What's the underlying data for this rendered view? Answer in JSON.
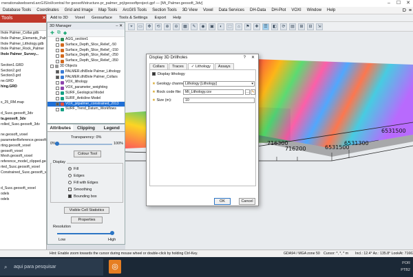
{
  "titlebar": {
    "text": "rnerationalwebsend.arcGIS/oil/central for geosoft/structure.pr_palmer_prj/geosoftproject.gpf — [Mt_Palmer.geosoft_3dv]",
    "controls": [
      "–",
      "☐",
      "✕"
    ]
  },
  "menubar": {
    "items": [
      "Database Tools",
      "Coordinates",
      "Grid and Image",
      "Map Tools",
      "ArcGIS Tools",
      "Section Tools",
      "3D View",
      "Voxel",
      "Data Services",
      "DH-Data",
      "DH-Plot",
      "VOXI",
      "Window",
      "Help"
    ],
    "right_icons": [
      "D",
      "≡"
    ]
  },
  "left_panel": {
    "header": "Tools",
    "header_close": "✕",
    "items": [
      {
        "text": "Ihole Palmer_Collar.gdb",
        "bold": false
      },
      {
        "text": "Ihole Palmer_Elements_Palmer",
        "bold": false
      },
      {
        "text": "Ihole Palmer_Lithology.gdb",
        "bold": false
      },
      {
        "text": "Ihole Palmer_Rock_Palmer",
        "bold": false
      },
      {
        "text": "Ihole Palmer_Survey...",
        "bold": true
      },
      {
        "text": "",
        "bold": false
      },
      {
        "text": "Section1.GRD",
        "bold": false
      },
      {
        "text": "Section2.grd",
        "bold": false
      },
      {
        "text": "Section3.grd",
        "bold": false
      },
      {
        "text": "ne.GRD",
        "bold": false
      },
      {
        "text": "hing.GRD",
        "bold": true
      },
      {
        "text": "",
        "bold": false
      },
      {
        "text": "",
        "bold": false
      },
      {
        "text": "s_25_RM.map",
        "bold": false
      },
      {
        "text": "",
        "bold": false
      },
      {
        "text": "d_Susc.geosoft_3dv",
        "bold": false
      },
      {
        "text": "ta.geosoft_3dv",
        "bold": true
      },
      {
        "text": "rolled_Susc.geosoft_3dv",
        "bold": false
      },
      {
        "text": "",
        "bold": false
      },
      {
        "text": "ne.geosoft_voxel",
        "bold": false
      },
      {
        "text": "parameterReference.geosoft_v",
        "bold": false
      },
      {
        "text": "rting.geosoft_voxel",
        "bold": false
      },
      {
        "text": "geosoft_voxel",
        "bold": false
      },
      {
        "text": "Mesh.geosoft_voxel",
        "bold": false
      },
      {
        "text": "reference_model_clipped.geo",
        "bold": false
      },
      {
        "text": "rted_Susc.geosoft_voxel",
        "bold": false
      },
      {
        "text": "Constrained_Susc.geosoft_v",
        "bold": false
      },
      {
        "text": "",
        "bold": false
      },
      {
        "text": "",
        "bold": false
      },
      {
        "text": "d_Susc.geosoft_voxel",
        "bold": false
      },
      {
        "text": "odels",
        "bold": false
      },
      {
        "text": "odels",
        "bold": false
      }
    ]
  },
  "topbar2": {
    "items": [
      "Add to 3D",
      "Voxel",
      "Geosurface",
      "Tools & Settings",
      "Export",
      "Help"
    ]
  },
  "toolbar3": {
    "buttons": [
      "⌖",
      "▭",
      "✥",
      "⟲",
      "⊕",
      "⊖",
      "▦",
      "✎",
      "◉",
      "▣",
      "◐",
      "⬚",
      "⌂",
      "⚑",
      "✚",
      "☰",
      "◧",
      "⟳",
      "▤",
      "⊞",
      "⊟",
      "⇲"
    ]
  },
  "manager": {
    "title": "3D Manager",
    "title_icons": "– ✕",
    "tools": [
      "✚",
      "⧉",
      "◆"
    ],
    "rows": [
      {
        "text": "AGG_section1",
        "checked": false,
        "color": "#2e8b57",
        "indent": 12,
        "selected": false
      },
      {
        "text": "Surface_Depth_Slice_Relief_-50",
        "checked": false,
        "color": "#d2691e",
        "indent": 12,
        "selected": false
      },
      {
        "text": "Surface_Depth_Slice_Relief_-150",
        "checked": false,
        "color": "#d2691e",
        "indent": 12,
        "selected": false
      },
      {
        "text": "Surface_Depth_Slice_Relief_-250",
        "checked": false,
        "color": "#d2691e",
        "indent": 12,
        "selected": false
      },
      {
        "text": "Surface_Depth_Slice_Relief_-350",
        "checked": false,
        "color": "#d2691e",
        "indent": 12,
        "selected": false
      },
      {
        "text": "3D Objects",
        "checked": false,
        "color": "#999999",
        "indent": 4,
        "selected": false
      },
      {
        "text": "PALMER.dhll9ole Palmer_Lithology",
        "checked": true,
        "color": "#3a7bd5",
        "indent": 12,
        "selected": false
      },
      {
        "text": "PALMER.dhll9ole Palmer_Collars",
        "checked": true,
        "color": "#3a7bd5",
        "indent": 12,
        "selected": false
      },
      {
        "text": "VOX_lithology",
        "checked": false,
        "color": "#8e44ad",
        "indent": 12,
        "selected": false
      },
      {
        "text": "VOX_parameter_weighting",
        "checked": false,
        "color": "#8e44ad",
        "indent": 12,
        "selected": false
      },
      {
        "text": "SURF_Geological Model",
        "checked": false,
        "color": "#16a085",
        "indent": 12,
        "selected": false
      },
      {
        "text": "SURF_Anticline Model",
        "checked": false,
        "color": "#16a085",
        "indent": 12,
        "selected": false
      },
      {
        "text": "VOX_jstpalmer_constrained_2013",
        "checked": true,
        "color": "#e74c3c",
        "indent": 12,
        "selected": true
      },
      {
        "text": "SURF_Trend_Datum_Workflows",
        "checked": false,
        "color": "#16a085",
        "indent": 12,
        "selected": false
      }
    ]
  },
  "attributes": {
    "tabs": [
      "Attributes",
      "Clipping",
      "Legend"
    ],
    "transparency_label": "Transparency: 0%",
    "min_label": "0%",
    "max_label": "100%",
    "transparency_value": 0,
    "colour_tool": "Colour Tool",
    "display_label": "Display",
    "options": [
      {
        "text": "Fill",
        "type": "radio",
        "on": true
      },
      {
        "text": "Edges",
        "type": "radio",
        "on": false
      },
      {
        "text": "Fill with Edges",
        "type": "radio",
        "on": false
      },
      {
        "text": "Smoothing",
        "type": "check",
        "on": false
      },
      {
        "text": "Bounding box",
        "type": "check",
        "on": true
      }
    ],
    "visible_cell_stats": "Visible Cell Statistics",
    "properties": "Properties",
    "resolution_label": "Resolution",
    "low": "Low",
    "high": "High",
    "resolution_value": 1.0
  },
  "viewport": {
    "axis_labels": [
      "6531500",
      "716300",
      "716200",
      "6531300",
      "6531500"
    ]
  },
  "dialog": {
    "title": "Display 3D Drillholes",
    "help": "?",
    "close": "✕",
    "tabs": [
      "Collars",
      "Traces",
      "Lithology",
      "Assays"
    ],
    "active_tab": 2,
    "display_lithology_label": "Display lithology",
    "display_lithology": true,
    "geology_channel_label": "Geology channel",
    "geology_channel_value": "Lithology [Lithology]",
    "rock_code_label": "Rock code file:",
    "rock_code_value": "Mt_Lithology.csv",
    "size_label": "Size (m):",
    "size_value": "10",
    "ok": "OK",
    "cancel": "Cancel"
  },
  "statusbar": {
    "hint": "Hint: Enable zoom towards the cursor during mouse wheel or double-click by holding Ctrl-Key.",
    "crs": "GDA94 / MGA zone 50",
    "cursor": "Cursor: *, *, * m",
    "view": "Incl.: 12.4° Az.: 135.8° LookAt: 716636."
  },
  "taskbar": {
    "search": "aqui para pesquisar",
    "apps": [
      {
        "glyph": "⬚",
        "color": "#4a6a8a"
      },
      {
        "glyph": "e",
        "color": "#1e73be"
      },
      {
        "glyph": "▭",
        "color": "#d4a017"
      },
      {
        "glyph": "◉",
        "color": "#3a9d3a"
      },
      {
        "glyph": "◆",
        "color": "#c0392b"
      },
      {
        "glyph": "W",
        "color": "#2b5797"
      },
      {
        "glyph": "✦",
        "color": "#8e44ad"
      },
      {
        "glyph": "◎",
        "color": "#e67e22"
      }
    ],
    "lang": "POR",
    "layout": "PTB2"
  }
}
